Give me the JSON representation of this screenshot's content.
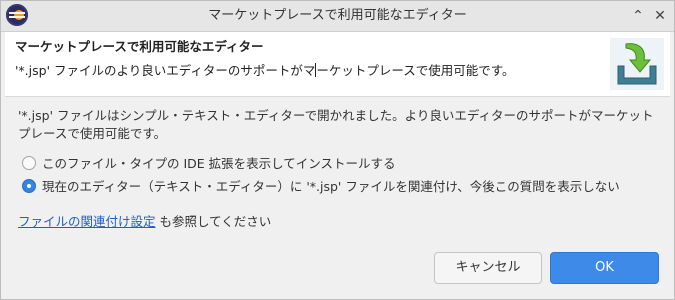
{
  "window": {
    "title": "マーケットプレースで利用可能なエディター",
    "controls": {
      "minimize": "⌃",
      "close": "✕"
    }
  },
  "header": {
    "title": "マーケットプレースで利用可能なエディター",
    "message_before_caret": "'*.jsp' ファイルのより良いエディターのサポートがマ",
    "message_after_caret": "ーケットプレースで使用可能です。",
    "icon": "download-arrow-icon"
  },
  "body": {
    "description": "'*.jsp' ファイルはシンプル・テキスト・エディターで開かれました。より良いエディターのサポートがマーケットプレースで使用可能です。"
  },
  "options": [
    {
      "label": "このファイル・タイプの IDE 拡張を表示してインストールする",
      "checked": false
    },
    {
      "label": "現在のエディター（テキスト・エディター）に '*.jsp' ファイルを関連付け、今後この質問を表示しない",
      "checked": true
    }
  ],
  "links": {
    "file_assoc": "ファイルの関連付け設定",
    "file_assoc_suffix": " も参照してください"
  },
  "buttons": {
    "cancel": "キャンセル",
    "ok": "OK"
  },
  "colors": {
    "accent": "#3d8ae9",
    "link": "#1a62c2"
  }
}
